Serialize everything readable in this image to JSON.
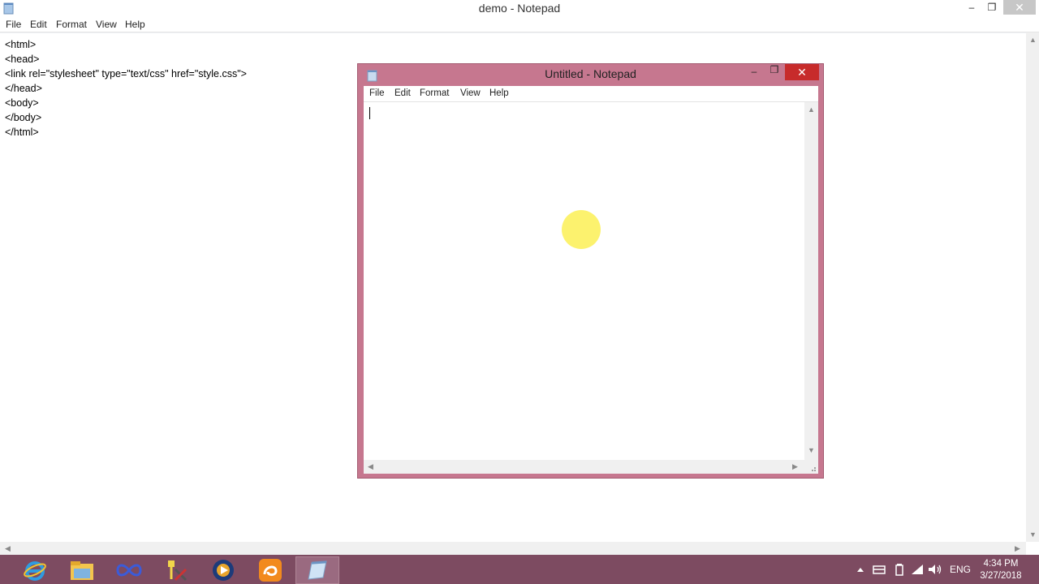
{
  "main_window": {
    "title": "demo - Notepad",
    "controls": {
      "minimize": "–",
      "maximize": "❐",
      "close": "✕"
    },
    "menu": [
      "File",
      "Edit",
      "Format",
      "View",
      "Help"
    ],
    "content": "<html>\n<head>\n<link rel=\"stylesheet\" type=\"text/css\" href=\"style.css\">\n</head>\n<body>\n</body>\n</html>"
  },
  "float_window": {
    "title": "Untitled - Notepad",
    "controls": {
      "minimize": "–",
      "maximize": "❐",
      "close": "✕"
    },
    "menu": [
      "File",
      "Edit",
      "Format",
      "View",
      "Help"
    ],
    "accent_color": "#c6778f",
    "close_color": "#c72b2b"
  },
  "taskbar": {
    "color": "#7d4b61",
    "apps": [
      "internet-explorer-icon",
      "file-explorer-icon",
      "infinity-app-icon",
      "tools-icon",
      "media-player-icon",
      "uc-browser-icon",
      "notepad-icon"
    ],
    "tray": {
      "language": "ENG"
    },
    "clock": {
      "time": "4:34 PM",
      "date": "3/27/2018"
    }
  },
  "scroll_arrows": {
    "up": "▲",
    "down": "▼",
    "left": "◀",
    "right": "▶"
  }
}
